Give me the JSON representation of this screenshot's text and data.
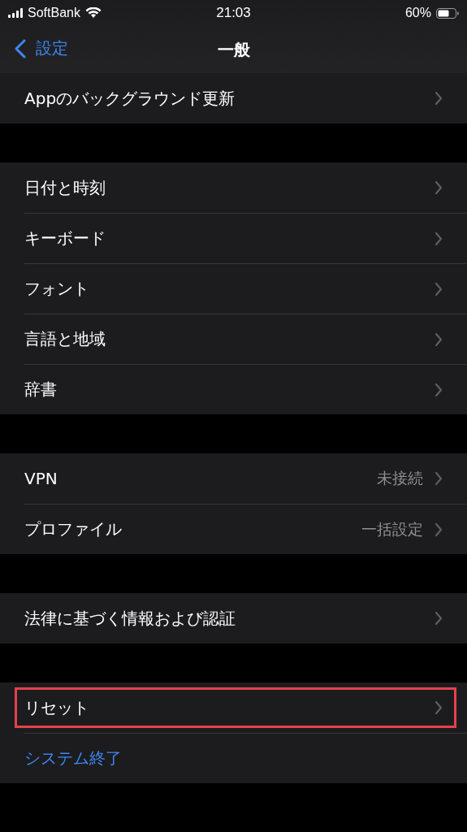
{
  "status_bar": {
    "carrier": "SoftBank",
    "time": "21:03",
    "battery": "60%"
  },
  "nav": {
    "back": "設定",
    "title": "一般"
  },
  "groups": [
    {
      "rows": [
        {
          "kind": "link",
          "label": "Appのバックグラウンド更新",
          "highlighted": false
        }
      ]
    },
    {
      "rows": [
        {
          "kind": "link",
          "label": "日付と時刻",
          "highlighted": false
        },
        {
          "kind": "link",
          "label": "キーボード",
          "highlighted": false
        },
        {
          "kind": "link",
          "label": "フォント",
          "highlighted": false
        },
        {
          "kind": "link",
          "label": "言語と地域",
          "highlighted": false
        },
        {
          "kind": "link",
          "label": "辞書",
          "highlighted": false
        }
      ]
    },
    {
      "rows": [
        {
          "kind": "link",
          "label": "VPN",
          "value": "未接続",
          "highlighted": false
        },
        {
          "kind": "link",
          "label": "プロファイル",
          "value": "一括設定",
          "highlighted": false
        }
      ]
    },
    {
      "rows": [
        {
          "kind": "link",
          "label": "法律に基づく情報および認証",
          "highlighted": false
        }
      ]
    },
    {
      "rows": [
        {
          "kind": "link",
          "label": "リセット",
          "highlighted": true
        },
        {
          "kind": "action",
          "label": "システム終了",
          "highlighted": false
        }
      ]
    }
  ]
}
